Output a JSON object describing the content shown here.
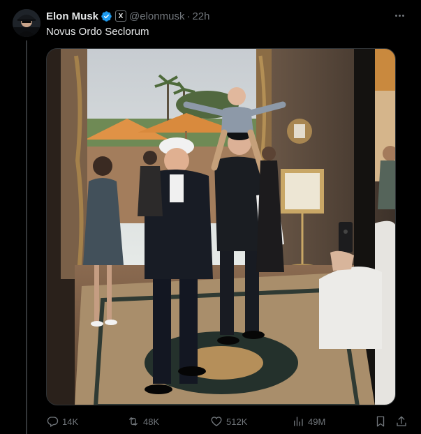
{
  "post": {
    "author_name": "Elon Musk",
    "handle": "@elonmusk",
    "separator": "·",
    "time": "22h",
    "text": "Novus Ordo Seclorum",
    "x_badge": "X",
    "icons": {
      "avatar": "avatar",
      "verified": "verified-badge-icon",
      "more": "more-icon"
    }
  },
  "media": {
    "photo_alt": "photo"
  },
  "actions": {
    "replies": "14K",
    "reposts": "48K",
    "likes": "512K",
    "views": "49M"
  },
  "colors": {
    "background": "#000000",
    "text_primary": "#e7e9ea",
    "text_secondary": "#71767b",
    "verified": "#1d9bf0",
    "divider": "#333639"
  }
}
